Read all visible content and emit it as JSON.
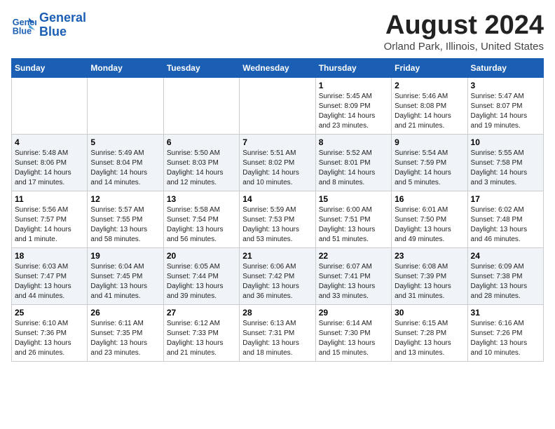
{
  "header": {
    "logo_line1": "General",
    "logo_line2": "Blue",
    "title": "August 2024",
    "subtitle": "Orland Park, Illinois, United States"
  },
  "days_of_week": [
    "Sunday",
    "Monday",
    "Tuesday",
    "Wednesday",
    "Thursday",
    "Friday",
    "Saturday"
  ],
  "weeks": [
    [
      {
        "day": "",
        "info": ""
      },
      {
        "day": "",
        "info": ""
      },
      {
        "day": "",
        "info": ""
      },
      {
        "day": "",
        "info": ""
      },
      {
        "day": "1",
        "info": "Sunrise: 5:45 AM\nSunset: 8:09 PM\nDaylight: 14 hours\nand 23 minutes."
      },
      {
        "day": "2",
        "info": "Sunrise: 5:46 AM\nSunset: 8:08 PM\nDaylight: 14 hours\nand 21 minutes."
      },
      {
        "day": "3",
        "info": "Sunrise: 5:47 AM\nSunset: 8:07 PM\nDaylight: 14 hours\nand 19 minutes."
      }
    ],
    [
      {
        "day": "4",
        "info": "Sunrise: 5:48 AM\nSunset: 8:06 PM\nDaylight: 14 hours\nand 17 minutes."
      },
      {
        "day": "5",
        "info": "Sunrise: 5:49 AM\nSunset: 8:04 PM\nDaylight: 14 hours\nand 14 minutes."
      },
      {
        "day": "6",
        "info": "Sunrise: 5:50 AM\nSunset: 8:03 PM\nDaylight: 14 hours\nand 12 minutes."
      },
      {
        "day": "7",
        "info": "Sunrise: 5:51 AM\nSunset: 8:02 PM\nDaylight: 14 hours\nand 10 minutes."
      },
      {
        "day": "8",
        "info": "Sunrise: 5:52 AM\nSunset: 8:01 PM\nDaylight: 14 hours\nand 8 minutes."
      },
      {
        "day": "9",
        "info": "Sunrise: 5:54 AM\nSunset: 7:59 PM\nDaylight: 14 hours\nand 5 minutes."
      },
      {
        "day": "10",
        "info": "Sunrise: 5:55 AM\nSunset: 7:58 PM\nDaylight: 14 hours\nand 3 minutes."
      }
    ],
    [
      {
        "day": "11",
        "info": "Sunrise: 5:56 AM\nSunset: 7:57 PM\nDaylight: 14 hours\nand 1 minute."
      },
      {
        "day": "12",
        "info": "Sunrise: 5:57 AM\nSunset: 7:55 PM\nDaylight: 13 hours\nand 58 minutes."
      },
      {
        "day": "13",
        "info": "Sunrise: 5:58 AM\nSunset: 7:54 PM\nDaylight: 13 hours\nand 56 minutes."
      },
      {
        "day": "14",
        "info": "Sunrise: 5:59 AM\nSunset: 7:53 PM\nDaylight: 13 hours\nand 53 minutes."
      },
      {
        "day": "15",
        "info": "Sunrise: 6:00 AM\nSunset: 7:51 PM\nDaylight: 13 hours\nand 51 minutes."
      },
      {
        "day": "16",
        "info": "Sunrise: 6:01 AM\nSunset: 7:50 PM\nDaylight: 13 hours\nand 49 minutes."
      },
      {
        "day": "17",
        "info": "Sunrise: 6:02 AM\nSunset: 7:48 PM\nDaylight: 13 hours\nand 46 minutes."
      }
    ],
    [
      {
        "day": "18",
        "info": "Sunrise: 6:03 AM\nSunset: 7:47 PM\nDaylight: 13 hours\nand 44 minutes."
      },
      {
        "day": "19",
        "info": "Sunrise: 6:04 AM\nSunset: 7:45 PM\nDaylight: 13 hours\nand 41 minutes."
      },
      {
        "day": "20",
        "info": "Sunrise: 6:05 AM\nSunset: 7:44 PM\nDaylight: 13 hours\nand 39 minutes."
      },
      {
        "day": "21",
        "info": "Sunrise: 6:06 AM\nSunset: 7:42 PM\nDaylight: 13 hours\nand 36 minutes."
      },
      {
        "day": "22",
        "info": "Sunrise: 6:07 AM\nSunset: 7:41 PM\nDaylight: 13 hours\nand 33 minutes."
      },
      {
        "day": "23",
        "info": "Sunrise: 6:08 AM\nSunset: 7:39 PM\nDaylight: 13 hours\nand 31 minutes."
      },
      {
        "day": "24",
        "info": "Sunrise: 6:09 AM\nSunset: 7:38 PM\nDaylight: 13 hours\nand 28 minutes."
      }
    ],
    [
      {
        "day": "25",
        "info": "Sunrise: 6:10 AM\nSunset: 7:36 PM\nDaylight: 13 hours\nand 26 minutes."
      },
      {
        "day": "26",
        "info": "Sunrise: 6:11 AM\nSunset: 7:35 PM\nDaylight: 13 hours\nand 23 minutes."
      },
      {
        "day": "27",
        "info": "Sunrise: 6:12 AM\nSunset: 7:33 PM\nDaylight: 13 hours\nand 21 minutes."
      },
      {
        "day": "28",
        "info": "Sunrise: 6:13 AM\nSunset: 7:31 PM\nDaylight: 13 hours\nand 18 minutes."
      },
      {
        "day": "29",
        "info": "Sunrise: 6:14 AM\nSunset: 7:30 PM\nDaylight: 13 hours\nand 15 minutes."
      },
      {
        "day": "30",
        "info": "Sunrise: 6:15 AM\nSunset: 7:28 PM\nDaylight: 13 hours\nand 13 minutes."
      },
      {
        "day": "31",
        "info": "Sunrise: 6:16 AM\nSunset: 7:26 PM\nDaylight: 13 hours\nand 10 minutes."
      }
    ]
  ]
}
